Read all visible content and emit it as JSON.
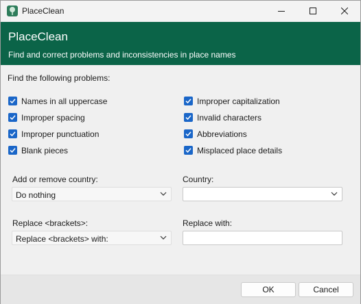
{
  "window": {
    "title": "PlaceClean",
    "controls": {
      "minimize": "minimize",
      "maximize": "maximize",
      "close": "close"
    }
  },
  "header": {
    "title": "PlaceClean",
    "subtitle": "Find and correct problems and inconsistencies in place names",
    "background_color": "#0b6448"
  },
  "problems": {
    "label": "Find the following problems:",
    "left": [
      {
        "label": "Names in all uppercase",
        "checked": true
      },
      {
        "label": "Improper spacing",
        "checked": true
      },
      {
        "label": "Improper punctuation",
        "checked": true
      },
      {
        "label": "Blank pieces",
        "checked": true
      }
    ],
    "right": [
      {
        "label": "Improper capitalization",
        "checked": true
      },
      {
        "label": "Invalid characters",
        "checked": true
      },
      {
        "label": "Abbreviations",
        "checked": true
      },
      {
        "label": "Misplaced place details",
        "checked": true
      }
    ],
    "check_color": "#1a66c8"
  },
  "fields": {
    "country_action": {
      "label": "Add or remove country:",
      "value": "Do nothing"
    },
    "country": {
      "label": "Country:",
      "value": ""
    },
    "brackets": {
      "label": "Replace <brackets>:",
      "value": "Replace <brackets> with:"
    },
    "replace_with": {
      "label": "Replace with:",
      "value": ""
    }
  },
  "buttons": {
    "ok": "OK",
    "cancel": "Cancel"
  }
}
